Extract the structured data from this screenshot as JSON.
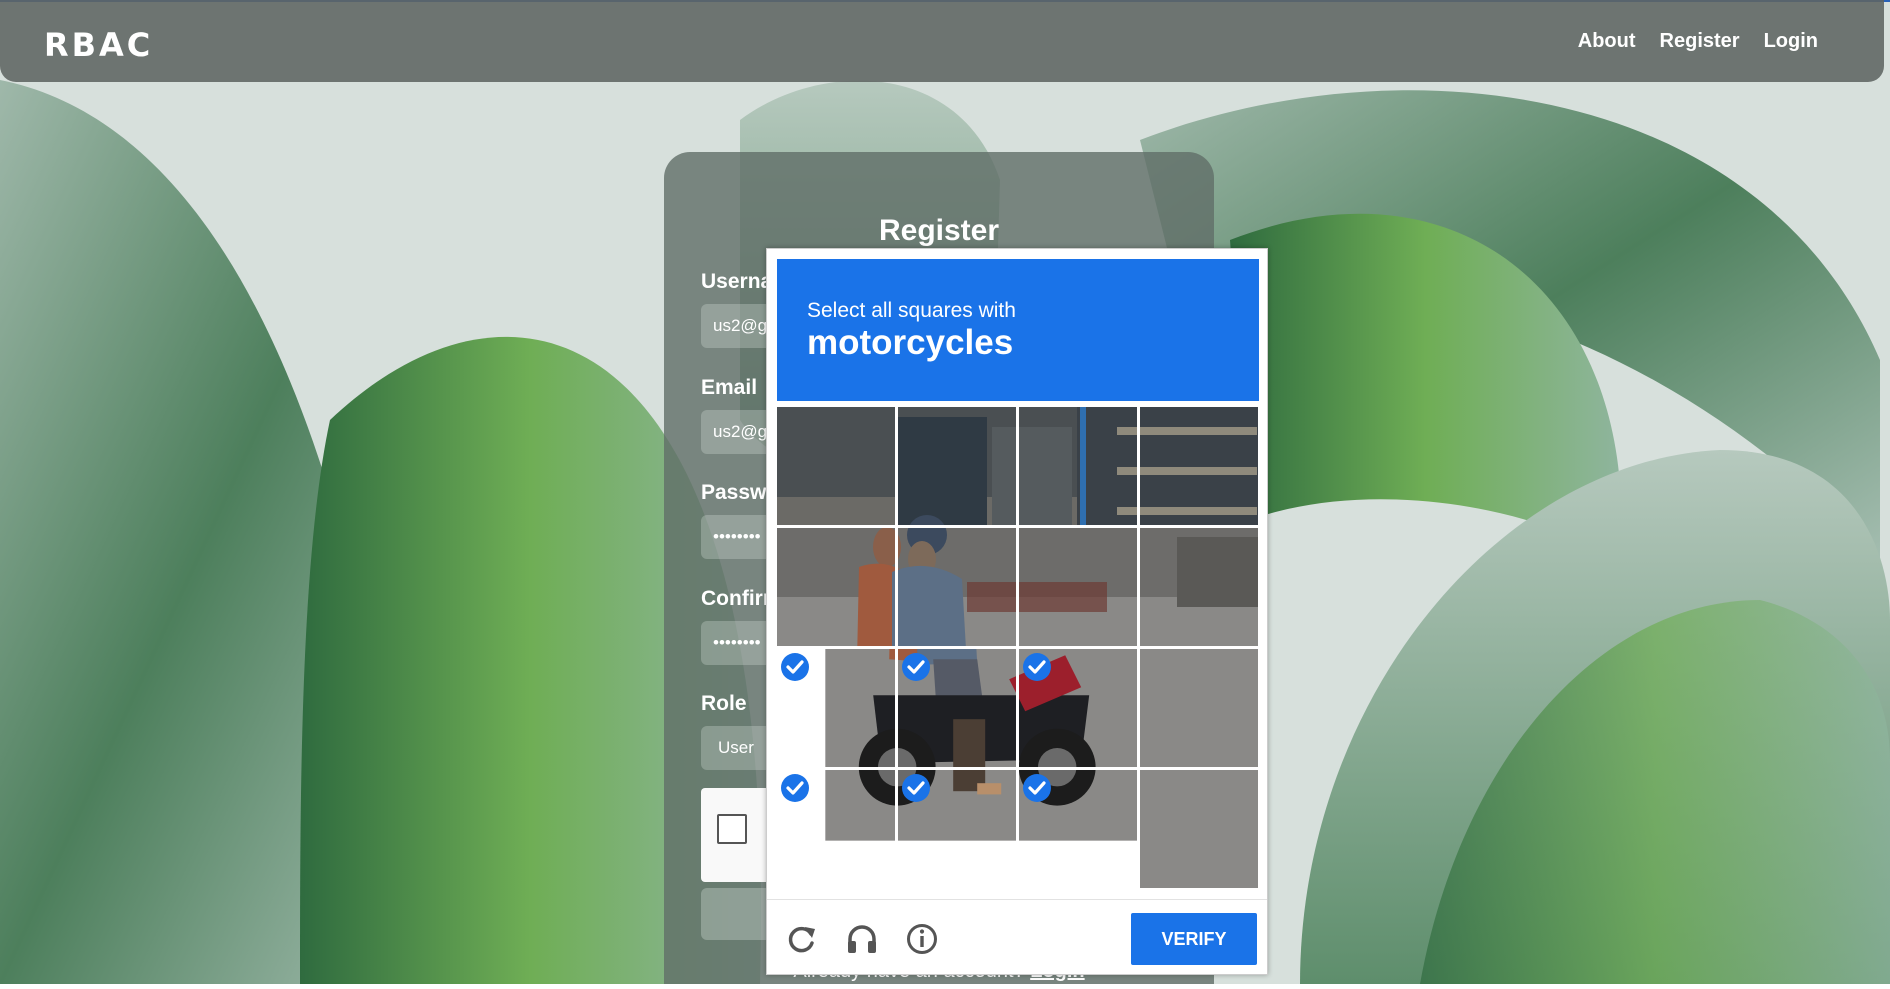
{
  "navbar": {
    "brand": "RBAC",
    "links": [
      "About",
      "Register",
      "Login"
    ]
  },
  "form": {
    "title": "Register",
    "fields": [
      {
        "label": "Userna",
        "value": "us2@g"
      },
      {
        "label": "Email",
        "value": "us2@g"
      },
      {
        "label": "Passw",
        "value": "••••••••"
      },
      {
        "label": "Confirm",
        "value": "••••••••"
      },
      {
        "label": "Role",
        "value": "User"
      }
    ],
    "already_text": "Already have an account?",
    "login_link": "Login"
  },
  "captcha": {
    "instruction": "Select all squares with",
    "target": "motorcycles",
    "verify_label": "VERIFY",
    "selected_tiles": [
      8,
      9,
      10,
      12,
      13,
      14
    ],
    "accent": "#1a73e8"
  },
  "icons": {
    "reload": "reload-icon",
    "audio": "headphones-icon",
    "info": "info-icon"
  }
}
